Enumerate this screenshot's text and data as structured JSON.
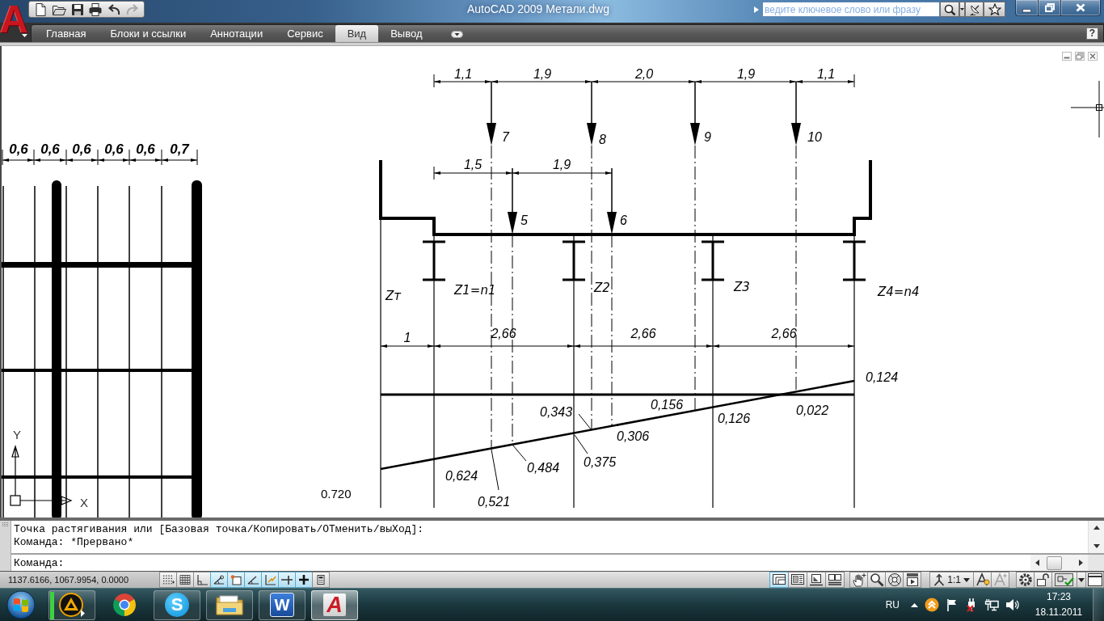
{
  "title_bar": {
    "logo": "A",
    "quick_access": [
      {
        "kind": "new",
        "disabled": false
      },
      {
        "kind": "open",
        "disabled": false
      },
      {
        "kind": "save",
        "disabled": false
      },
      {
        "kind": "print",
        "disabled": false
      },
      {
        "kind": "undo",
        "disabled": false
      },
      {
        "kind": "redo",
        "disabled": true
      }
    ],
    "title": "AutoCAD 2009 Метали.dwg",
    "search": {
      "placeholder": "ведите ключевое слово или фразу"
    }
  },
  "ribbon": {
    "tabs": [
      {
        "label": "Главная",
        "selected": false
      },
      {
        "label": "Блоки и ссылки",
        "selected": false
      },
      {
        "label": "Аннотации",
        "selected": false
      },
      {
        "label": "Сервис",
        "selected": false
      },
      {
        "label": "Вид",
        "selected": true
      },
      {
        "label": "Вывод",
        "selected": false
      }
    ],
    "help": "?"
  },
  "drawing": {
    "frame_dimensions": [
      "0,6",
      "0,6",
      "0,6",
      "0,6",
      "0,6",
      "0,7"
    ],
    "ucs": {
      "y_label": "Y",
      "x_label": "X"
    },
    "top_dimensions": [
      "1,1",
      "1,9",
      "2,0",
      "1,9",
      "1,1"
    ],
    "upper_loads": [
      "7",
      "8",
      "9",
      "10"
    ],
    "load_dimensions": [
      "1,5",
      "1,9"
    ],
    "lower_loads": [
      "5",
      "6"
    ],
    "beams": [
      "Zт",
      "Z1=n1",
      "Z2",
      "Z3",
      "Z4=n4"
    ],
    "span_dimensions": [
      "1",
      "2,66",
      "2,66",
      "2,66"
    ],
    "ordinates": [
      "0,124",
      "0,343",
      "0,156",
      "0,126",
      "0,022",
      "0,306",
      "0,624",
      "0,484",
      "0,375",
      "0,521"
    ],
    "note": "0.720"
  },
  "command_line": {
    "history": [
      "Точка растягивания или [Базовая точка/Копировать/ОТменить/выХод]:",
      "Команда: *Прервано*"
    ],
    "prompt": "Команда:"
  },
  "status_bar": {
    "coordinates": "1137.6166, 1067.9954, 0.0000",
    "toggles": [
      {
        "kind": "snap",
        "on": false
      },
      {
        "kind": "grid",
        "on": false
      },
      {
        "kind": "ortho",
        "on": false
      },
      {
        "kind": "polar",
        "on": true
      },
      {
        "kind": "osnap",
        "on": true
      },
      {
        "kind": "otrack",
        "on": true
      },
      {
        "kind": "ducs",
        "on": true
      },
      {
        "kind": "dyn",
        "on": true
      },
      {
        "kind": "lwt",
        "on": true
      },
      {
        "kind": "qp",
        "on": false
      }
    ],
    "layout_tools": [
      {
        "kind": "model",
        "on": true
      },
      {
        "kind": "layouts",
        "on": false
      },
      {
        "kind": "layout",
        "on": false
      },
      {
        "kind": "drawings",
        "on": false
      }
    ],
    "navigation_tools": [
      {
        "kind": "pan"
      },
      {
        "kind": "zoom"
      },
      {
        "kind": "wheel"
      },
      {
        "kind": "motion"
      }
    ],
    "annotation_scale": "1:1",
    "annotation_tools": [
      {
        "kind": "visibility",
        "disabled": false
      },
      {
        "kind": "autoscale",
        "disabled": true
      }
    ],
    "tray_tools": [
      {
        "kind": "workspace"
      },
      {
        "kind": "lock"
      },
      {
        "kind": "tray"
      },
      {
        "kind": "menu"
      },
      {
        "kind": "cleanscreen"
      }
    ]
  },
  "taskbar": {
    "apps": [
      {
        "kind": "player",
        "running": true,
        "selected": false
      },
      {
        "kind": "browser",
        "running": false,
        "selected": false
      },
      {
        "kind": "messenger",
        "glyph": "S",
        "running": true,
        "selected": false
      },
      {
        "kind": "files",
        "running": true,
        "selected": false
      },
      {
        "kind": "writer",
        "glyph": "W",
        "running": true,
        "selected": false
      },
      {
        "kind": "cad",
        "glyph": "A",
        "running": true,
        "selected": true
      }
    ],
    "language": "RU",
    "time": "17:23",
    "date": "18.11.2011"
  }
}
